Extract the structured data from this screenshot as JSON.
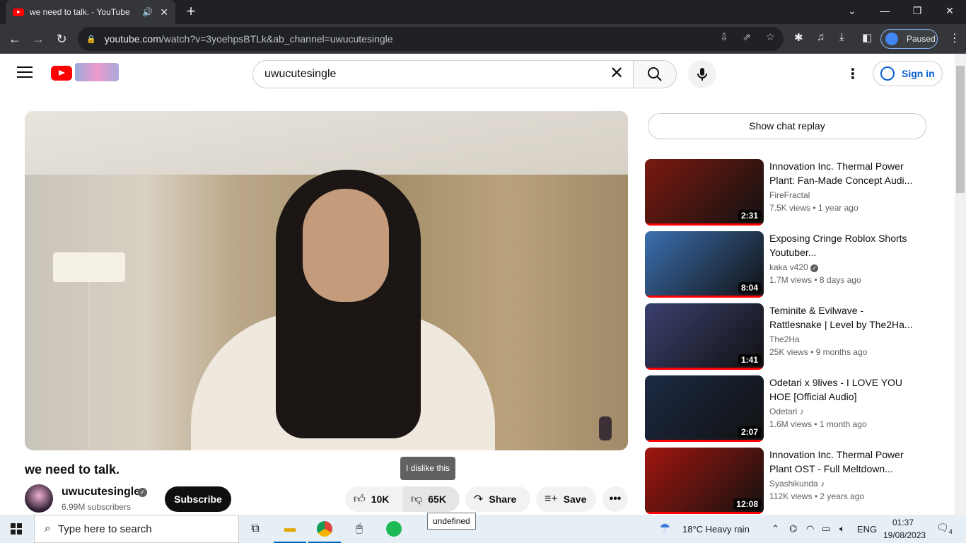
{
  "browser": {
    "tab_title": "we need to talk. - YouTube",
    "url_domain": "youtube.com",
    "url_path": "/watch?v=3yoehpsBTLk&ab_channel=uwucutesingle",
    "profile_label": "Paused"
  },
  "youtube": {
    "search_value": "uwucutesingle",
    "sign_in_label": "Sign in",
    "video_title": "we need to talk.",
    "channel_name": "uwucutesingle",
    "subscribers": "6.99M subscribers",
    "subscribe_label": "Subscribe",
    "like_count": "10K",
    "dislike_count": "65K",
    "share_label": "Share",
    "save_label": "Save",
    "dislike_tooltip": "I dislike this",
    "undefined_tooltip": "undefined",
    "chat_replay_label": "Show chat replay"
  },
  "recommendations": [
    {
      "title": "Innovation Inc. Thermal Power Plant: Fan-Made Concept Audi...",
      "channel": "FireFractal",
      "views": "7.5K views",
      "age": "1 year ago",
      "duration": "2:31",
      "verified": false,
      "music": false,
      "color": "#7a1a10"
    },
    {
      "title": "Exposing Cringe Roblox Shorts Youtuber...",
      "channel": "kaka v420",
      "views": "1.7M views",
      "age": "8 days ago",
      "duration": "8:04",
      "verified": true,
      "music": false,
      "color": "#3b6fb0"
    },
    {
      "title": "Teminite & Evilwave - Rattlesnake | Level by The2Ha...",
      "channel": "The2Ha",
      "views": "25K views",
      "age": "9 months ago",
      "duration": "1:41",
      "verified": false,
      "music": false,
      "color": "#3a3f6e"
    },
    {
      "title": "Odetari x 9lives - I LOVE YOU HOE [Official Audio]",
      "channel": "Odetari",
      "views": "1.6M views",
      "age": "1 month ago",
      "duration": "2:07",
      "verified": false,
      "music": true,
      "color": "#1c2a44"
    },
    {
      "title": "Innovation Inc. Thermal Power Plant OST - Full Meltdown...",
      "channel": "Syashikunda",
      "views": "112K views",
      "age": "2 years ago",
      "duration": "12:08",
      "verified": false,
      "music": true,
      "color": "#a2160f"
    }
  ],
  "taskbar": {
    "search_placeholder": "Type here to search",
    "weather": "18°C  Heavy rain",
    "language": "ENG",
    "time": "01:37",
    "date": "19/08/2023",
    "notifications": "4"
  }
}
